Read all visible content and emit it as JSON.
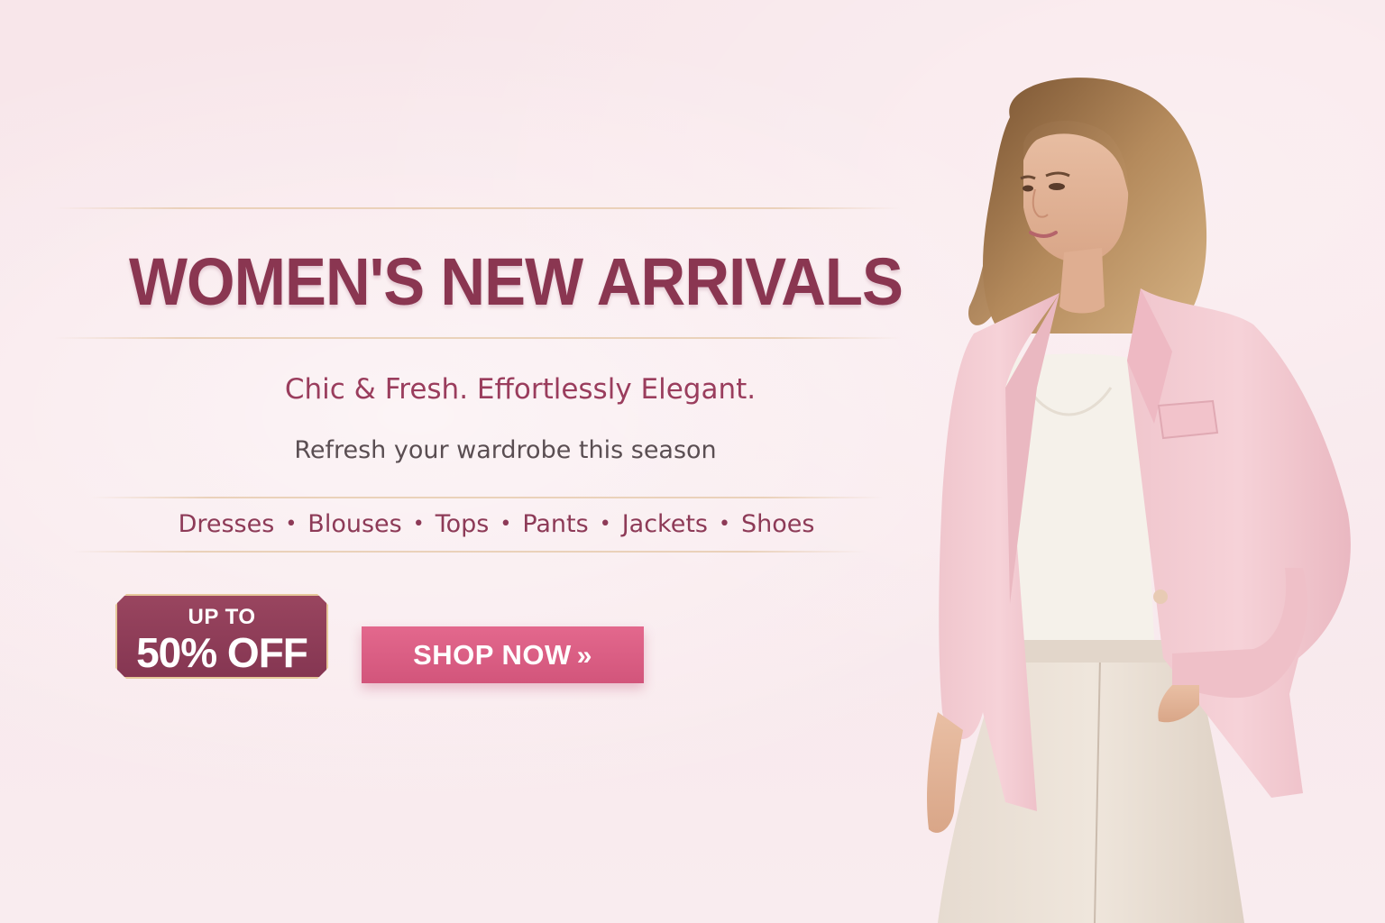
{
  "banner": {
    "title": "WOMEN'S NEW ARRIVALS",
    "tagline": "Chic & Fresh. Effortlessly Elegant.",
    "subtitle": "Refresh your wardrobe this season",
    "categories": [
      "Dresses",
      "Blouses",
      "Tops",
      "Pants",
      "Jackets",
      "Shoes"
    ],
    "separator": "•",
    "badge": {
      "top": "UP TO",
      "main": "50% OFF"
    },
    "cta": {
      "label": "SHOP NOW",
      "arrow": "»"
    },
    "model_image": "model-photo"
  },
  "colors": {
    "background": "#f8e6ea",
    "title": "#8a3651",
    "tagline": "#9a3d5d",
    "subtitle": "#5a4e52",
    "badge": "#8f3c58",
    "badge_border": "#e6c89a",
    "cta": "#d9607f",
    "divider": "#e8ceb4"
  }
}
